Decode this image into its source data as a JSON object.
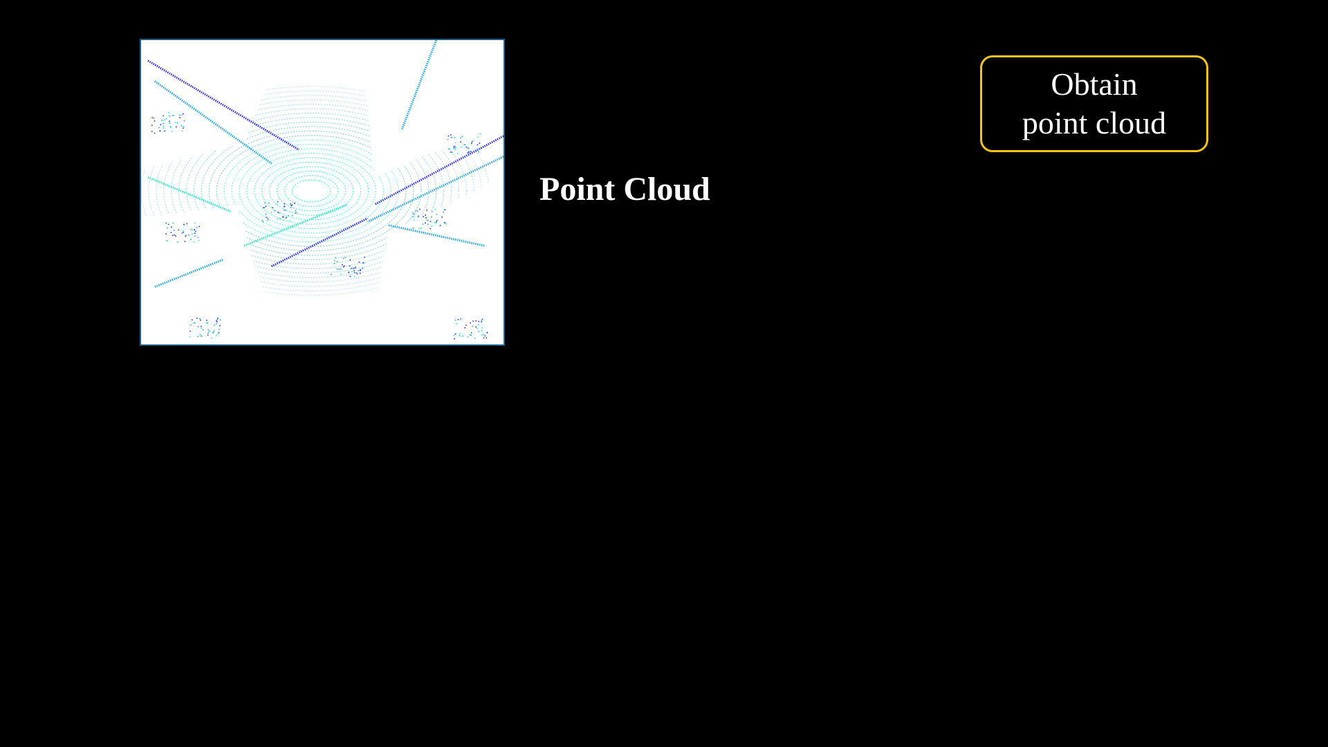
{
  "panel": {
    "label": "Point Cloud",
    "image_alt": "LiDAR point cloud of a street intersection"
  },
  "step": {
    "line1": "Obtain",
    "line2": "point cloud"
  },
  "colors": {
    "background": "#000000",
    "frame_border": "#1f5f8b",
    "step_border": "#f5c518",
    "text": "#ffffff",
    "points_near": "#2ee6c8",
    "points_mid": "#1fa0e0",
    "points_far": "#2a2ad8"
  }
}
